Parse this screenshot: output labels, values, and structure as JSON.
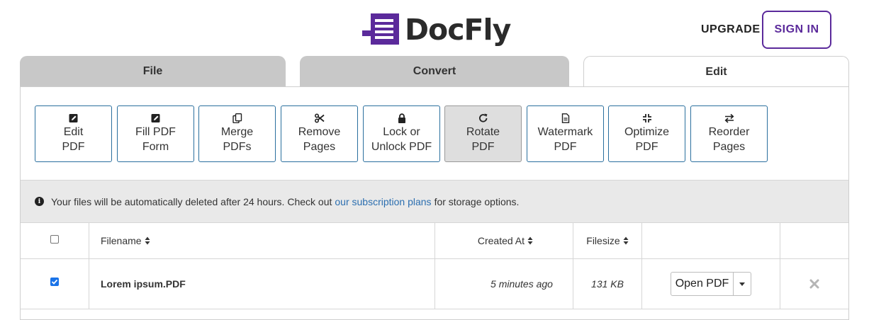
{
  "brand": {
    "name": "DocFly",
    "logo_color": "#5b2a9b"
  },
  "header": {
    "upgrade_label": "UPGRADE",
    "signin_label": "SIGN IN"
  },
  "tabs": [
    {
      "label": "File",
      "active": false
    },
    {
      "label": "Convert",
      "active": false
    },
    {
      "label": "Edit",
      "active": true
    }
  ],
  "tools": [
    {
      "label": "Edit\nPDF",
      "icon": "edit-icon"
    },
    {
      "label": "Fill PDF\nForm",
      "icon": "edit-icon"
    },
    {
      "label": "Merge\nPDFs",
      "icon": "copy-icon"
    },
    {
      "label": "Remove\nPages",
      "icon": "scissors-icon"
    },
    {
      "label": "Lock or\nUnlock PDF",
      "icon": "lock-icon"
    },
    {
      "label": "Rotate\nPDF",
      "icon": "rotate-icon",
      "selected": true
    },
    {
      "label": "Watermark\nPDF",
      "icon": "document-icon"
    },
    {
      "label": "Optimize\nPDF",
      "icon": "compress-icon"
    },
    {
      "label": "Reorder\nPages",
      "icon": "swap-icon"
    }
  ],
  "notice": {
    "text_before": "Your files will be automatically deleted after 24 hours. Check out",
    "link_text": "our subscription plans",
    "text_after": "for storage options."
  },
  "table": {
    "columns": {
      "filename": "Filename",
      "created_at": "Created At",
      "filesize": "Filesize"
    },
    "rows": [
      {
        "checked": true,
        "filename": "Lorem ipsum.PDF",
        "created_at": "5 minutes ago",
        "filesize": "131 KB",
        "action_label": "Open PDF"
      }
    ]
  }
}
